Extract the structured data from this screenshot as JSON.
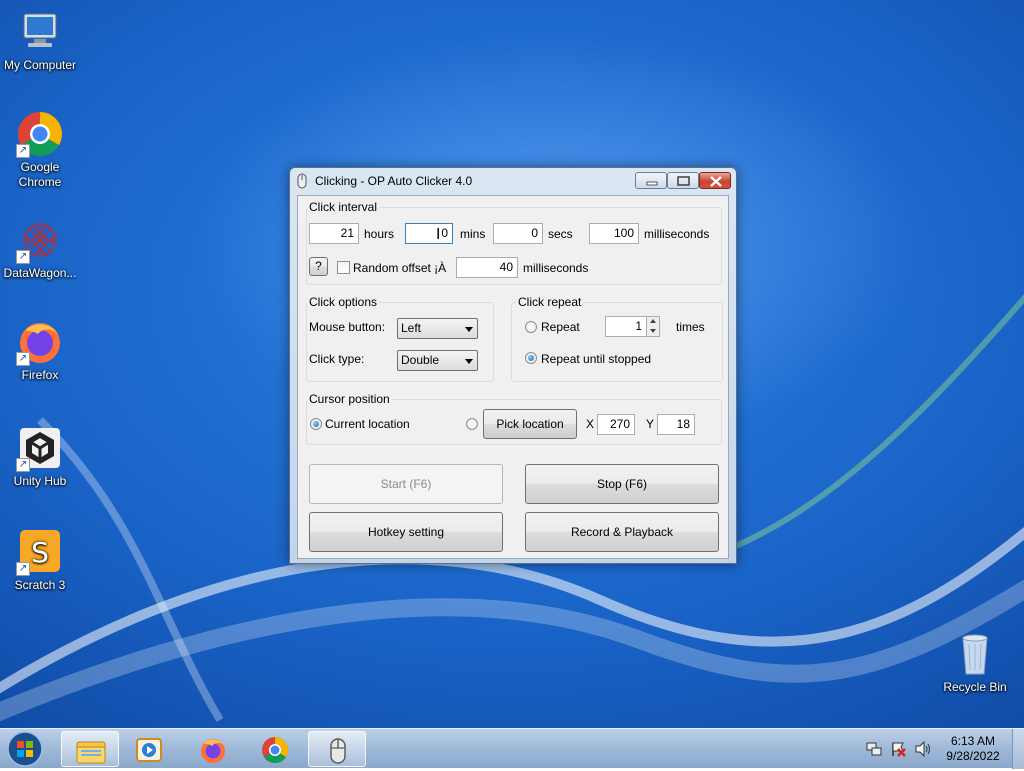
{
  "desktop": {
    "icons": [
      {
        "label": "My Computer"
      },
      {
        "label": "Google Chrome"
      },
      {
        "label": "DataWagon..."
      },
      {
        "label": "Firefox"
      },
      {
        "label": "Unity Hub"
      },
      {
        "label": "Scratch 3"
      },
      {
        "label": "Recycle Bin"
      }
    ]
  },
  "window": {
    "title": "Clicking - OP Auto Clicker 4.0",
    "click_interval": {
      "label": "Click interval",
      "hours_value": "21",
      "hours_label": "hours",
      "mins_value": "0",
      "mins_label": "mins",
      "secs_value": "0",
      "secs_label": "secs",
      "ms_value": "100",
      "ms_label": "milliseconds",
      "help_label": "?",
      "random_offset_label": "Random offset ¡À",
      "random_offset_checked": false,
      "offset_value": "40",
      "offset_unit": "milliseconds"
    },
    "click_options": {
      "label": "Click options",
      "mouse_button_label": "Mouse button:",
      "mouse_button_value": "Left",
      "click_type_label": "Click type:",
      "click_type_value": "Double"
    },
    "click_repeat": {
      "label": "Click repeat",
      "repeat_label": "Repeat",
      "repeat_value": "1",
      "times_label": "times",
      "until_stopped_label": "Repeat until stopped",
      "selected": "until_stopped"
    },
    "cursor_position": {
      "label": "Cursor position",
      "current_label": "Current location",
      "pick_label": "Pick location",
      "x_label": "X",
      "x_value": "270",
      "y_label": "Y",
      "y_value": "18",
      "selected": "current"
    },
    "buttons": {
      "start": "Start (F6)",
      "stop": "Stop (F6)",
      "hotkey": "Hotkey setting",
      "record": "Record & Playback"
    }
  },
  "taskbar": {
    "items": [
      "explorer-icon",
      "media-player-icon",
      "firefox-icon",
      "chrome-icon",
      "op-auto-clicker-icon"
    ],
    "clock_time": "6:13 AM",
    "clock_date": "9/28/2022"
  }
}
